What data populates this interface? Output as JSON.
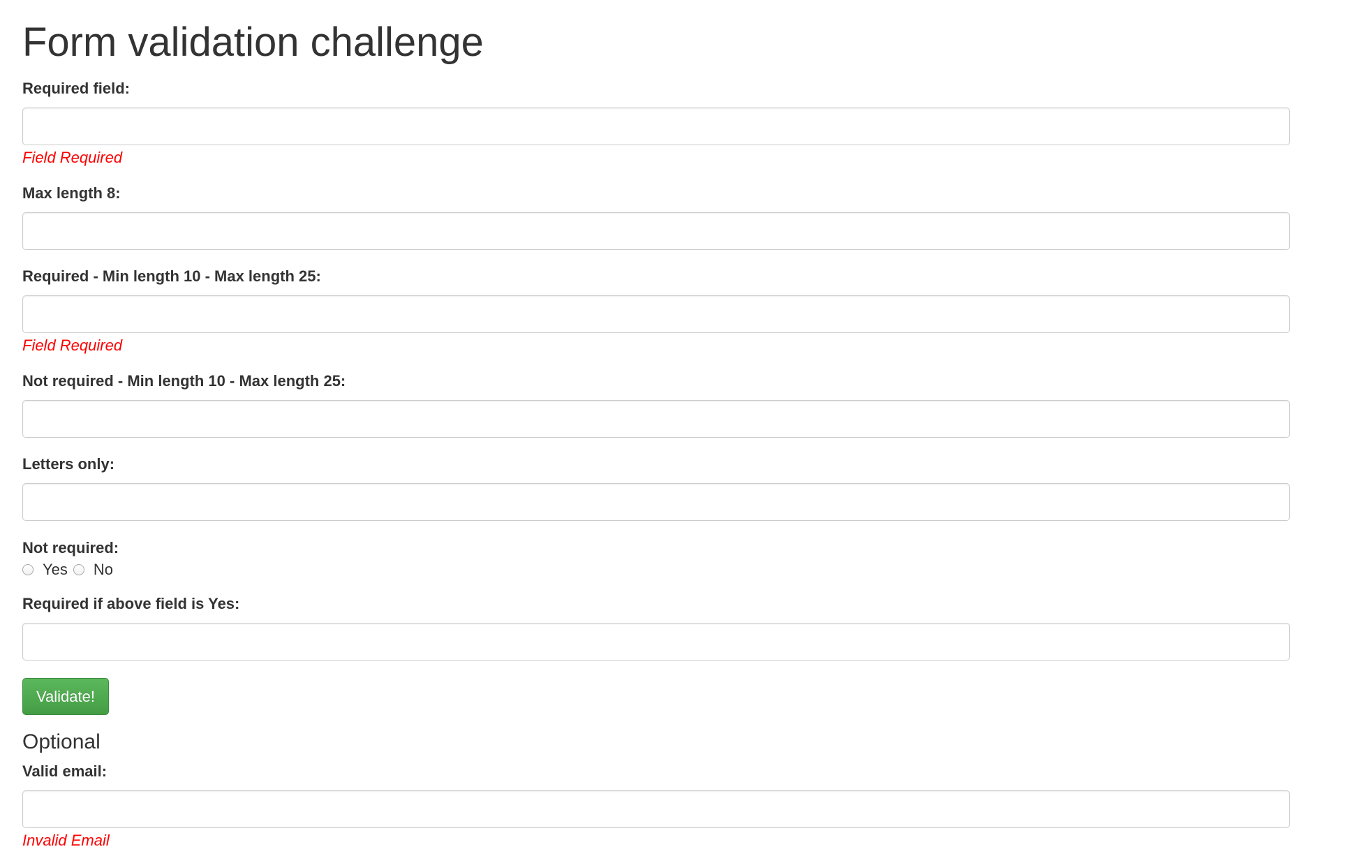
{
  "page": {
    "title": "Form validation challenge"
  },
  "form": {
    "required_field": {
      "label": "Required field:",
      "value": "",
      "error": "Field Required"
    },
    "max_length_8": {
      "label": "Max length 8:",
      "value": ""
    },
    "required_min_max": {
      "label": "Required - Min length 10 - Max length 25:",
      "value": "",
      "error": "Field Required"
    },
    "not_required_min_max": {
      "label": "Not required - Min length 10 - Max length 25:",
      "value": ""
    },
    "letters_only": {
      "label": "Letters only:",
      "value": ""
    },
    "not_required_radio": {
      "label": "Not required:",
      "options": [
        "Yes",
        "No"
      ]
    },
    "required_if_yes": {
      "label": "Required if above field is Yes:",
      "value": ""
    },
    "validate_label": "Validate!"
  },
  "optional": {
    "title": "Optional",
    "valid_email": {
      "label": "Valid email:",
      "value": "",
      "error": "Invalid Email"
    }
  },
  "colors": {
    "error": "#ff0000",
    "button": "#5cb85c",
    "text": "#333333"
  }
}
